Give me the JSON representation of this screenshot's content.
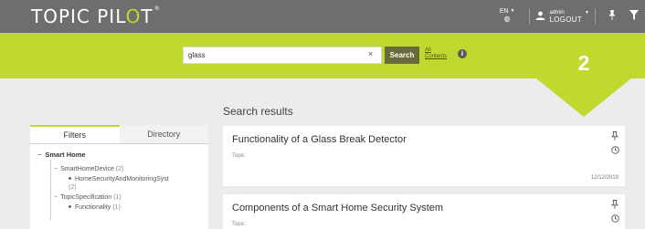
{
  "app": {
    "logo_main": "TOPIC PIL",
    "logo_accent": "O",
    "logo_end": "T",
    "logo_mark": "®"
  },
  "header": {
    "language": "EN",
    "language_icon": "globe-icon",
    "user_name": "admin",
    "logout_label": "LOGOUT",
    "icons": [
      "user-icon",
      "pin-icon",
      "filter-icon"
    ]
  },
  "search": {
    "value": "glass",
    "clear_label": "×",
    "button_label": "Search",
    "scope_line1": "All",
    "scope_line2": "Contents",
    "info_label": "i"
  },
  "results_count": "2",
  "results_heading": "Search results",
  "filters": {
    "tabs": [
      {
        "label": "Filters",
        "active": true
      },
      {
        "label": "Directory",
        "active": false
      }
    ],
    "root": "Smart Home",
    "groups": [
      {
        "label": "SmartHomeDevice",
        "count": "(2)",
        "items": [
          {
            "label": "HomeSecurityAndMonitoringSyst",
            "count": "(2)"
          }
        ]
      },
      {
        "label": "TopicSpecification",
        "count": "(1)",
        "items": [
          {
            "label": "Functionality",
            "count": "(1)"
          }
        ]
      }
    ]
  },
  "results": [
    {
      "title": "Functionality of a Glass Break Detector",
      "type": "Topic",
      "date": "12/12/2019"
    },
    {
      "title": "Components of a Smart Home Security System",
      "type": "Topic",
      "date": ""
    }
  ],
  "colors": {
    "accent": "#c1d82f",
    "topbar": "#6e6e6e",
    "search_button": "#6b6b3a",
    "background": "#ececec"
  }
}
